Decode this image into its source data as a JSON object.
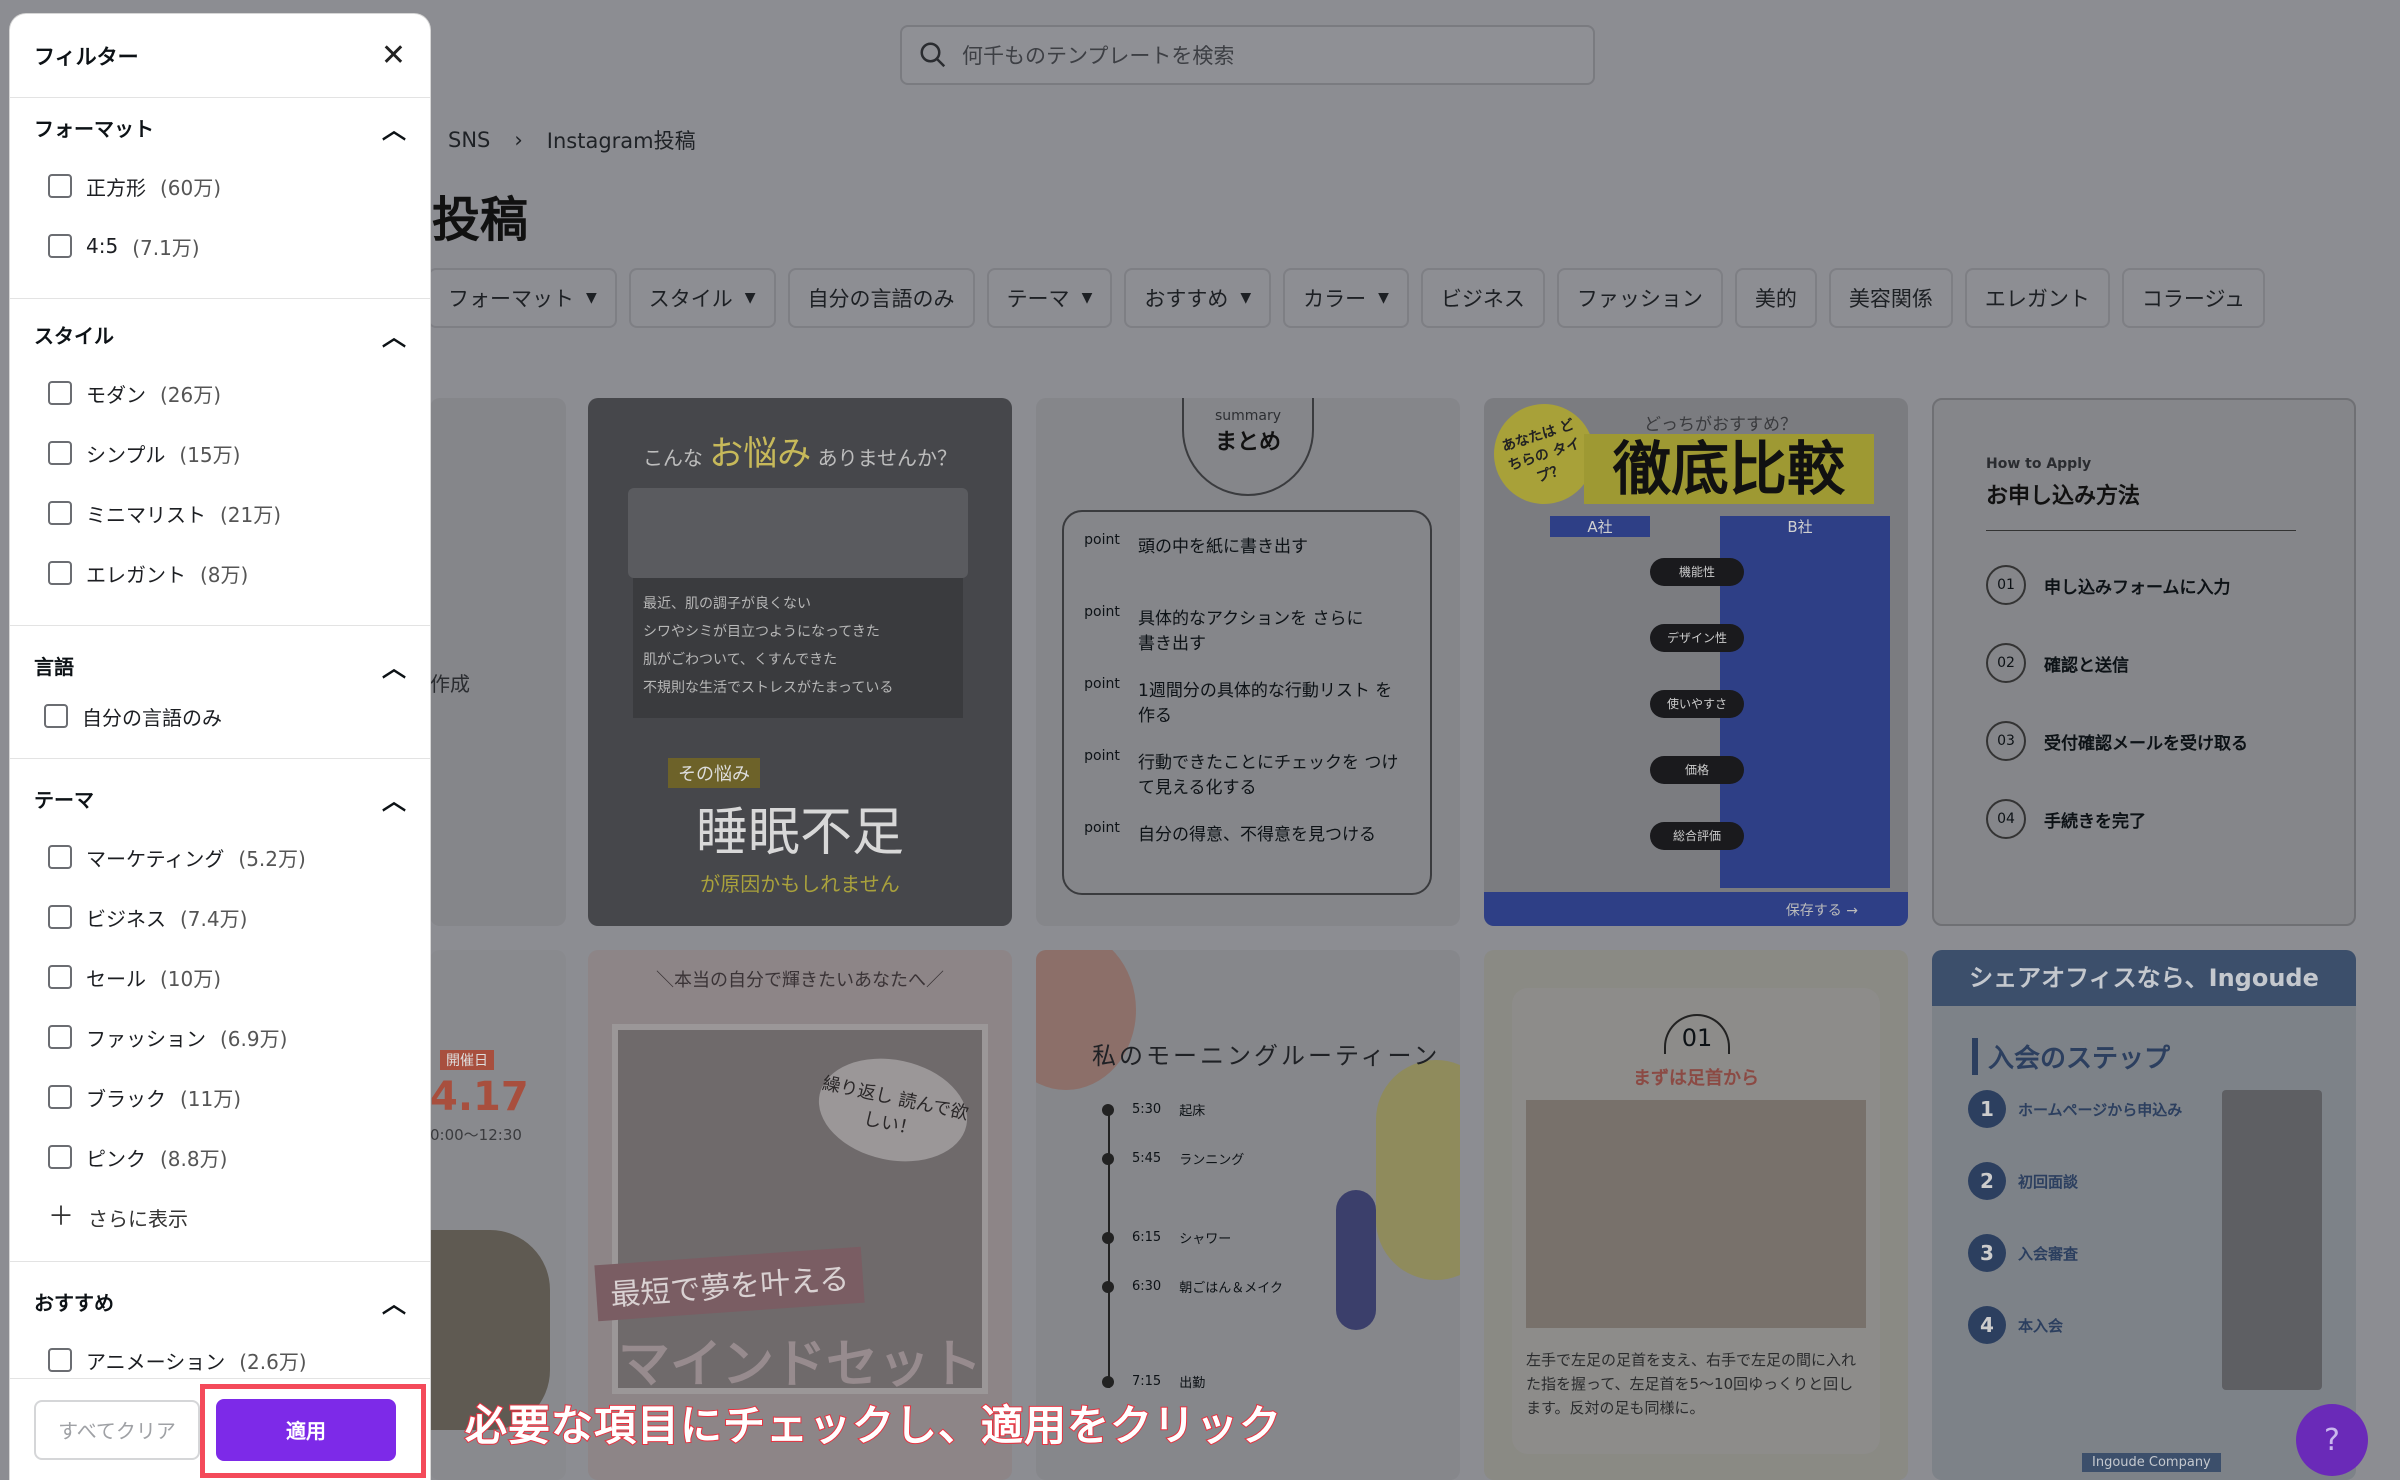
{
  "search": {
    "placeholder": "何千ものテンプレートを検索"
  },
  "breadcrumb": {
    "items": [
      "SNS",
      "Instagram投稿"
    ],
    "separator": "›"
  },
  "page": {
    "title_fragment": "投稿"
  },
  "chips": [
    {
      "label": "フォーマット",
      "dropdown": true
    },
    {
      "label": "スタイル",
      "dropdown": true
    },
    {
      "label": "自分の言語のみ",
      "dropdown": false
    },
    {
      "label": "テーマ",
      "dropdown": true
    },
    {
      "label": "おすすめ",
      "dropdown": true
    },
    {
      "label": "カラー",
      "dropdown": true
    },
    {
      "label": "ビジネス",
      "dropdown": false
    },
    {
      "label": "ファッション",
      "dropdown": false
    },
    {
      "label": "美的",
      "dropdown": false
    },
    {
      "label": "美容関係",
      "dropdown": false
    },
    {
      "label": "エレガント",
      "dropdown": false
    },
    {
      "label": "コラージュ",
      "dropdown": false
    }
  ],
  "partial_text": "作成",
  "cards": {
    "c1": {
      "line1": "こんな",
      "hl": "お悩み",
      "line2": "ありませんか？",
      "items": [
        "最近、肌の調子が良くない",
        "シワやシミが目立つようになってきた",
        "肌がごわついて、くすんできた",
        "不規則な生活でストレスがたまっている"
      ],
      "tag": "その悩み",
      "big": "睡眠不足",
      "sub": "が原因かもしれません"
    },
    "c2": {
      "small": "summary",
      "title": "まとめ",
      "points": [
        "頭の中を紙に書き出す",
        "具体的なアクションを さらに書き出す",
        "1週間分の具体的な行動リスト を作る",
        "行動できたことにチェックを つけて見える化する",
        "自分の得意、不得意を見つける"
      ],
      "plabel": "point"
    },
    "c3": {
      "badge": "あなたは どちらの タイプ？",
      "top": "どっちがおすすめ？",
      "title": "徹底比較",
      "a": "A社",
      "b": "B社",
      "rows": [
        "機能性",
        "デザイン性",
        "使いやすさ",
        "価格",
        "総合評価"
      ],
      "save": "保存する →"
    },
    "c4": {
      "small": "How to Apply",
      "title": "お申し込み方法",
      "steps": [
        {
          "n": "01",
          "t": "申し込みフォームに入力"
        },
        {
          "n": "02",
          "t": "確認と送信"
        },
        {
          "n": "03",
          "t": "受付確認メールを受け取る"
        },
        {
          "n": "04",
          "t": "手続きを完了"
        }
      ]
    },
    "c5": {
      "tag": "開催日",
      "date": "4.17",
      "time": "0:00〜12:30"
    },
    "c6": {
      "top": "＼本当の自分で輝きたいあなたへ／",
      "bubble": "繰り返し 読んで欲しい！",
      "t1": "最短で夢を叶える",
      "t2": "マインドセット"
    },
    "c7": {
      "title": "私のモーニングルーティーン",
      "items": [
        {
          "t": "5:30",
          "a": "起床"
        },
        {
          "t": "5:45",
          "a": "ランニング"
        },
        {
          "t": "6:15",
          "a": "シャワー"
        },
        {
          "t": "6:30",
          "a": "朝ごはん＆メイク"
        },
        {
          "t": "7:15",
          "a": "出勤"
        }
      ]
    },
    "c8": {
      "num": "01",
      "title": "まずは足首から",
      "body": "左手で左足の足首を支え、右手で左足の間に入れた指を握って、左足首を5〜10回ゆっくりと回します。反対の足も同様に。"
    },
    "c9": {
      "top": "シェアオフィスなら、Ingoude",
      "title": "入会のステップ",
      "steps": [
        {
          "n": "1",
          "t": "ホームページから申込み"
        },
        {
          "n": "2",
          "t": "初回面談"
        },
        {
          "n": "3",
          "t": "入会審査"
        },
        {
          "n": "4",
          "t": "本入会"
        }
      ],
      "footer": "Ingoude Company"
    }
  },
  "filter": {
    "title": "フィルター",
    "sections": [
      {
        "name": "フォーマット",
        "options": [
          {
            "label": "正方形",
            "count": "(60万)"
          },
          {
            "label": "4:5",
            "count": "(7.1万)"
          }
        ]
      },
      {
        "name": "スタイル",
        "options": [
          {
            "label": "モダン",
            "count": "(26万)"
          },
          {
            "label": "シンプル",
            "count": "(15万)"
          },
          {
            "label": "ミニマリスト",
            "count": "(21万)"
          },
          {
            "label": "エレガント",
            "count": "(8万)"
          }
        ]
      },
      {
        "name": "言語",
        "options": [
          {
            "label": "自分の言語のみ",
            "count": ""
          }
        ]
      },
      {
        "name": "テーマ",
        "options": [
          {
            "label": "マーケティング",
            "count": "(5.2万)"
          },
          {
            "label": "ビジネス",
            "count": "(7.4万)"
          },
          {
            "label": "セール",
            "count": "(10万)"
          },
          {
            "label": "ファッション",
            "count": "(6.9万)"
          },
          {
            "label": "ブラック",
            "count": "(11万)"
          },
          {
            "label": "ピンク",
            "count": "(8.8万)"
          }
        ],
        "more": "さらに表示"
      },
      {
        "name": "おすすめ",
        "options": [
          {
            "label": "アニメーション",
            "count": "(2.6万)"
          }
        ]
      }
    ],
    "clear_label": "すべてクリア",
    "apply_label": "適用"
  },
  "annotation": {
    "text": "必要な項目にチェックし、適用をクリック",
    "color": "#f44a5a"
  },
  "help": {
    "label": "?"
  },
  "colors": {
    "accent": "#7d2ae8",
    "overlay": "#8c8d92",
    "highlight": "#f44a5a"
  }
}
